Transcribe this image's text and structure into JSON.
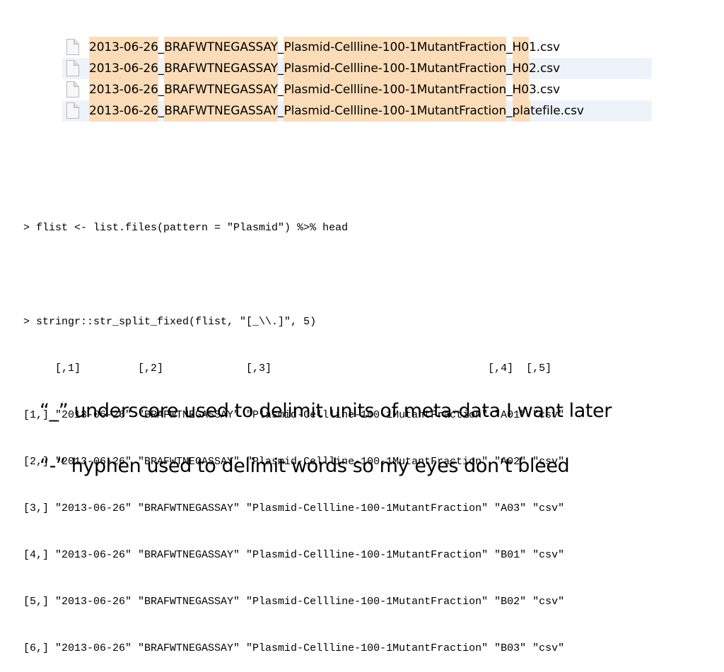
{
  "files": [
    {
      "date": "2013-06-26",
      "sep1": "_",
      "assay": "BRAFWTNEGASSAY",
      "sep2": "_",
      "sample": "Plasmid-Cellline-100-1MutantFraction",
      "sep3": "_",
      "well_hl": "H0",
      "rest": "1.csv"
    },
    {
      "date": "2013-06-26",
      "sep1": "_",
      "assay": "BRAFWTNEGASSAY",
      "sep2": "_",
      "sample": "Plasmid-Cellline-100-1MutantFraction",
      "sep3": "_",
      "well_hl": "H0",
      "rest": "2.csv"
    },
    {
      "date": "2013-06-26",
      "sep1": "_",
      "assay": "BRAFWTNEGASSAY",
      "sep2": "_",
      "sample": "Plasmid-Cellline-100-1MutantFraction",
      "sep3": "_",
      "well_hl": "H0",
      "rest": "3.csv"
    },
    {
      "date": "2013-06-26",
      "sep1": "_",
      "assay": "BRAFWTNEGASSAY",
      "sep2": "_",
      "sample": "Plasmid-Cellline-100-1MutantFraction",
      "sep3": "_",
      "well_hl": "pla",
      "rest": "tefile.csv"
    }
  ],
  "console": {
    "cmd1": "> flist <- list.files(pattern = \"Plasmid\") %>% head",
    "cmd2": "> stringr::str_split_fixed(flist, \"[_\\\\.]\", 5)",
    "header": "     [,1]         [,2]             [,3]                                  [,4]  [,5] ",
    "rows": [
      "[1,] \"2013-06-26\" \"BRAFWTNEGASSAY\" \"Plasmid-Cellline-100-1MutantFraction\" \"A01\" \"csv\"",
      "[2,] \"2013-06-26\" \"BRAFWTNEGASSAY\" \"Plasmid-Cellline-100-1MutantFraction\" \"A02\" \"csv\"",
      "[3,] \"2013-06-26\" \"BRAFWTNEGASSAY\" \"Plasmid-Cellline-100-1MutantFraction\" \"A03\" \"csv\"",
      "[4,] \"2013-06-26\" \"BRAFWTNEGASSAY\" \"Plasmid-Cellline-100-1MutantFraction\" \"B01\" \"csv\"",
      "[5,] \"2013-06-26\" \"BRAFWTNEGASSAY\" \"Plasmid-Cellline-100-1MutantFraction\" \"B02\" \"csv\"",
      "[6,] \"2013-06-26\" \"BRAFWTNEGASSAY\" \"Plasmid-Cellline-100-1MutantFraction\" \"B03\" \"csv\""
    ]
  },
  "notes": [
    "“_” underscore used to delimit units of meta-data I want later",
    "“-” hyphen used to delimit words so my eyes don’t bleed"
  ],
  "colors": {
    "highlight": "#fbdcb8",
    "alt_row": "#eef3fa"
  },
  "icons": {
    "file": "document-icon"
  }
}
